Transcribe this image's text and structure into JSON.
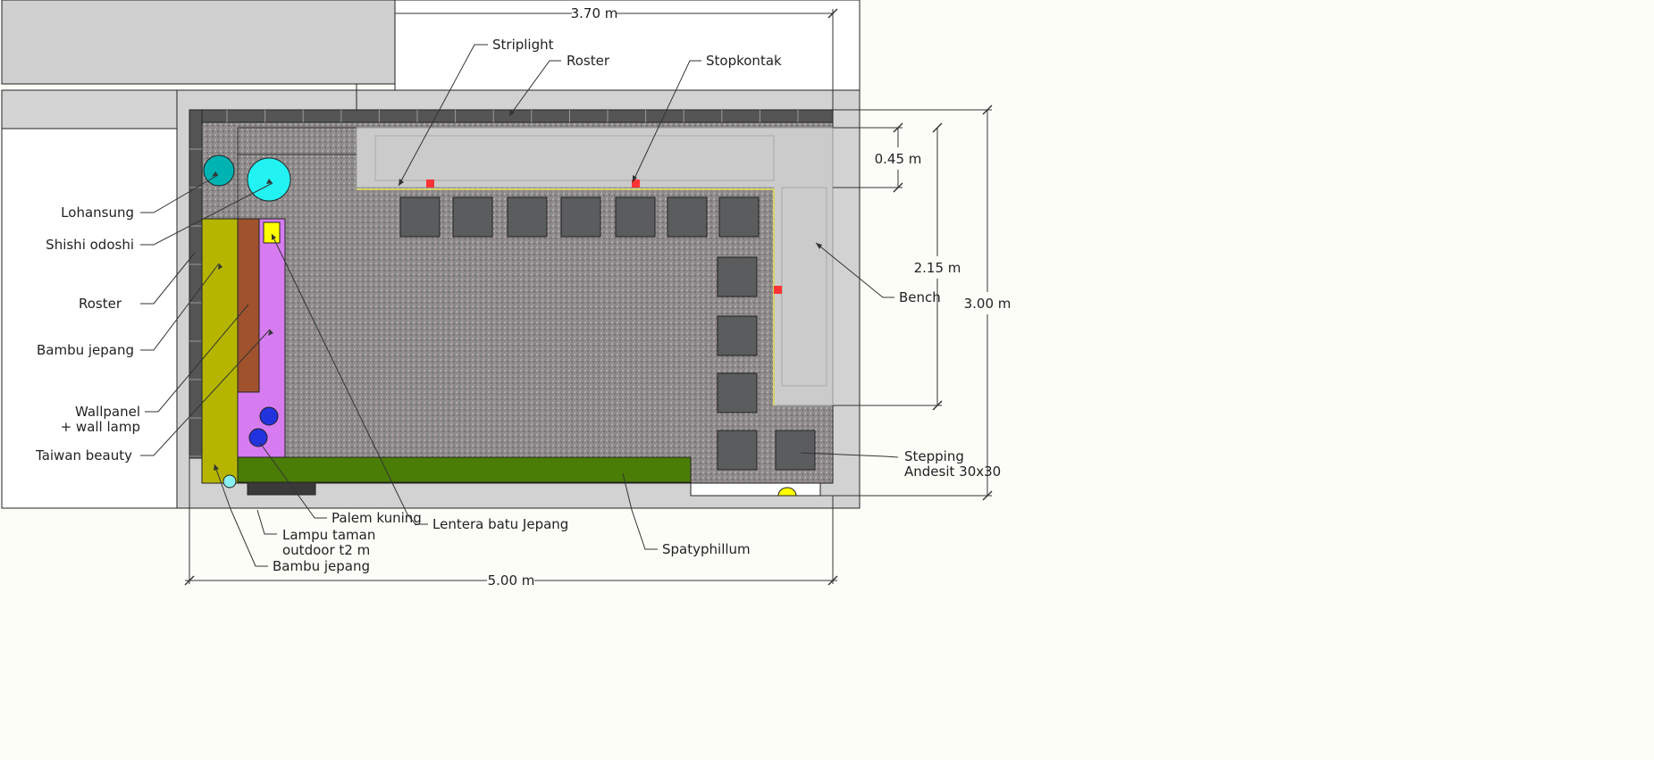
{
  "colors": {
    "paving": "#d2d2d2",
    "gravel": "#8a8586",
    "bench": "#cbcbcb",
    "roster_block": "#555555",
    "bambu_jepang": "#b5b500",
    "wallpanel": "#a0522d",
    "taiwan_beauty": "#d67cf0",
    "spatyphillum": "#4a7d06",
    "lohansung": "#00b3b3",
    "shishi_odoshi": "#22f2f2",
    "lentera": "#ffff00",
    "stopkontak": "#ff3333",
    "palem_kuning": "#2233dd",
    "lampu_taman": "#ff3030",
    "stepping_stone": "#5a5c5e"
  },
  "dimensions": {
    "top_width": "3.70 m",
    "bench_depth": "0.45 m",
    "bench_length": "2.15 m",
    "total_depth": "3.00 m",
    "total_width": "5.00 m"
  },
  "labels": {
    "striplight": "Striplight",
    "roster_top": "Roster",
    "stopkontak": "Stopkontak",
    "lohansung": "Lohansung",
    "shishi_odoshi": "Shishi odoshi",
    "roster_left": "Roster",
    "bambu_jepang_left": "Bambu jepang",
    "wallpanel_1": "Wallpanel",
    "wallpanel_2": "+ wall lamp",
    "taiwan_beauty": "Taiwan beauty",
    "bench": "Bench",
    "stepping_1": "Stepping",
    "stepping_2": "Andesit 30x30",
    "palem_kuning": "Palem kuning",
    "lentera": "Lentera batu Jepang",
    "lampu_1": "Lampu taman",
    "lampu_2": "outdoor t2 m",
    "bambu_jepang_bottom": "Bambu jepang",
    "spatyphillum": "Spatyphillum"
  }
}
